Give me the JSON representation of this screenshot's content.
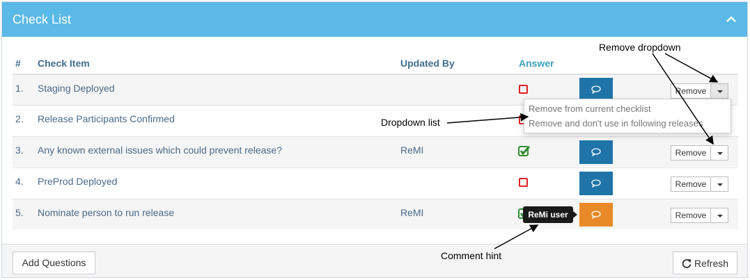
{
  "panel": {
    "title": "Check List"
  },
  "table": {
    "headers": {
      "num": "#",
      "item": "Check Item",
      "updated_by": "Updated By",
      "answer": "Answer"
    },
    "rows": [
      {
        "num": "1.",
        "item": "Staging Deployed",
        "updated_by": "",
        "answer": "unchecked",
        "comment_color": "#1f75a8"
      },
      {
        "num": "2.",
        "item": "Release Participants Confirmed",
        "updated_by": "",
        "answer": "unchecked",
        "comment_color": "#1f75a8"
      },
      {
        "num": "3.",
        "item": "Any known external issues which could prevent release?",
        "updated_by": "ReMI",
        "answer": "checked",
        "comment_color": "#1f75a8"
      },
      {
        "num": "4.",
        "item": "PreProd Deployed",
        "updated_by": "",
        "answer": "unchecked",
        "comment_color": "#1f75a8"
      },
      {
        "num": "5.",
        "item": "Nominate person to run release",
        "updated_by": "ReMI",
        "answer": "checked",
        "comment_color": "#e98a28"
      }
    ],
    "remove_label": "Remove"
  },
  "dropdown": {
    "items": [
      "Remove from current checklist",
      "Remove and don't use in following releases"
    ]
  },
  "tooltip": {
    "text": "ReMi user"
  },
  "footer": {
    "add_label": "Add Questions",
    "refresh_label": "Refresh"
  },
  "annotations": {
    "remove_dropdown": "Remove dropdown",
    "dropdown_list": "Dropdown list",
    "comment_hint": "Comment hint"
  },
  "colors": {
    "header_bg": "#5ab9e6",
    "comment_blue": "#1f75a8",
    "comment_orange": "#e98a28",
    "unchecked_red": "#e02020",
    "checked_green": "#2e8b2e"
  },
  "icons": {
    "collapse": "chevron-up-icon",
    "comment": "comment-icon",
    "refresh": "refresh-icon",
    "caret": "caret-down-icon"
  }
}
